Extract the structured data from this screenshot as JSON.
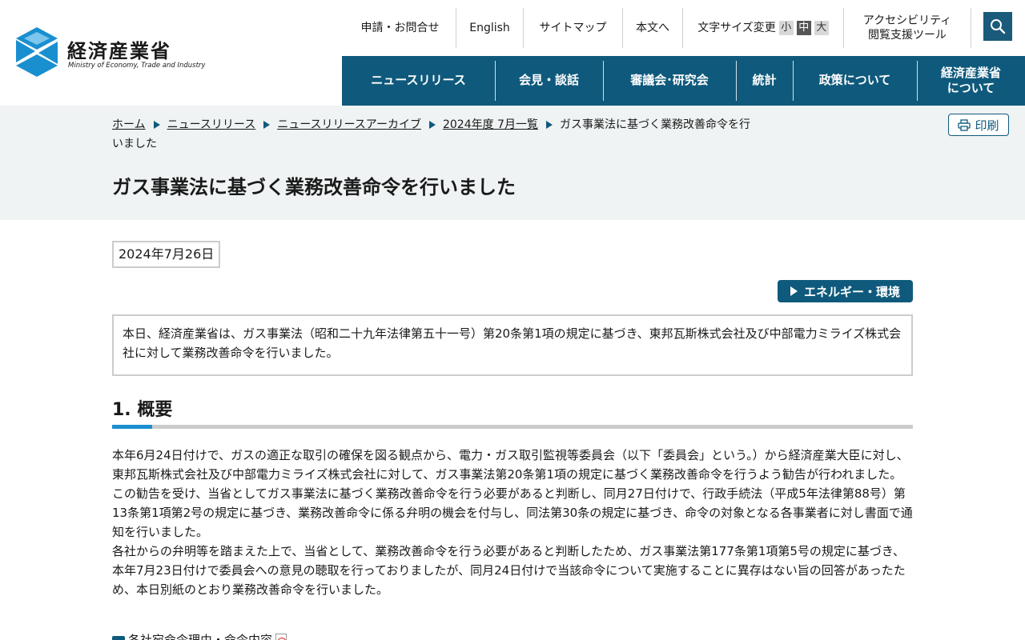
{
  "header": {
    "logo_text": "経済産業省",
    "logo_sub": "Ministry of Economy, Trade and Industry",
    "util_nav": {
      "contact": "申請・お問合せ",
      "english": "English",
      "sitemap": "サイトマップ",
      "skip": "本文へ",
      "font_size_label": "文字サイズ変更",
      "font_small": "小",
      "font_mid": "中",
      "font_large": "大",
      "accessibility_line1": "アクセシビリティ",
      "accessibility_line2": "閲覧支援ツール"
    },
    "main_nav": {
      "news": "ニュースリリース",
      "press": "会見・談話",
      "council": "審議会･研究会",
      "stats": "統計",
      "policy": "政策について",
      "about_line1": "経済産業省",
      "about_line2": "について"
    }
  },
  "breadcrumb": {
    "home": "ホーム",
    "news": "ニュースリリース",
    "archive": "ニュースリリースアーカイブ",
    "month": "2024年度 7月一覧",
    "current": "ガス事業法に基づく業務改善命令を行いました"
  },
  "print_label": "印刷",
  "page_title": "ガス事業法に基づく業務改善命令を行いました",
  "date": "2024年7月26日",
  "category": "エネルギー・環境",
  "summary": "本日、経済産業省は、ガス事業法（昭和二十九年法律第五十一号）第20条第1項の規定に基づき、東邦瓦斯株式会社及び中部電力ミライズ株式会社に対して業務改善命令を行いました。",
  "section1": {
    "title": "1.  概要",
    "paragraphs": [
      "本年6月24日付けで、ガスの適正な取引の確保を図る観点から、電力・ガス取引監視等委員会（以下「委員会」という。）から経済産業大臣に対し、東邦瓦斯株式会社及び中部電力ミライズ株式会社に対して、ガス事業法第20条第1項の規定に基づく業務改善命令を行うよう勧告が行われました。",
      "この勧告を受け、当省としてガス事業法に基づく業務改善命令を行う必要があると判断し、同月27日付けで、行政手続法（平成5年法律第88号）第13条第1項第2号の規定に基づき、業務改善命令に係る弁明の機会を付与し、同法第30条の規定に基づき、命令の対象となる各事業者に対し書面で通知を行いました。",
      "各社からの弁明等を踏まえた上で、当省として、業務改善命令を行う必要があると判断したため、ガス事業法第177条第1項第5号の規定に基づき、本年7月23日付けで委員会への意見の聴取を行っておりましたが、同月24日付けで当該命令について実施することに異存はない旨の回答があったため、本日別紙のとおり業務改善命令を行いました。"
    ]
  },
  "attachment": "各社宛命令理由・命令内容",
  "colors": {
    "nav_bg": "#0f5a7c",
    "band_bg": "#eff3f3",
    "accent": "#1a8fd0"
  }
}
